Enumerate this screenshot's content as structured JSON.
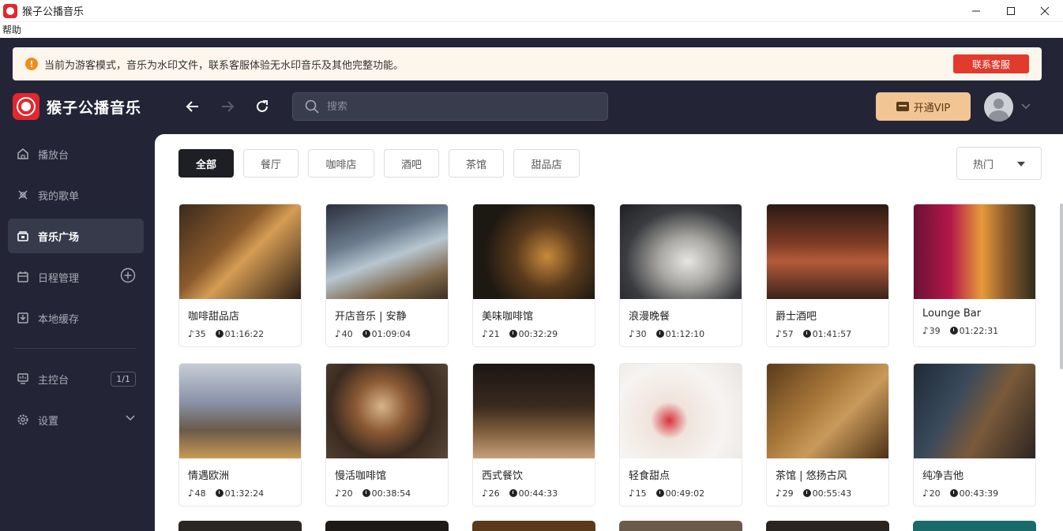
{
  "window": {
    "title": "猴子公播音乐"
  },
  "menu": {
    "help": "帮助"
  },
  "notice": {
    "text": "当前为游客模式，音乐为水印文件，联系客服体验无水印音乐及其他完整功能。",
    "button": "联系客服"
  },
  "brand": {
    "name": "猴子公播音乐"
  },
  "search": {
    "placeholder": "搜索"
  },
  "vip": {
    "label": "开通VIP"
  },
  "sidebar": {
    "items": [
      {
        "label": "播放台"
      },
      {
        "label": "我的歌单"
      },
      {
        "label": "音乐广场"
      },
      {
        "label": "日程管理"
      },
      {
        "label": "本地缓存"
      },
      {
        "label": "主控台",
        "badge": "1/1"
      },
      {
        "label": "设置"
      }
    ]
  },
  "filters": {
    "chips": [
      "全部",
      "餐厅",
      "咖啡店",
      "酒吧",
      "茶馆",
      "甜品店"
    ],
    "sort": "热门"
  },
  "playlists": [
    {
      "name": "咖啡甜品店",
      "count": "35",
      "duration": "01:16:22"
    },
    {
      "name": "开店音乐 | 安静",
      "count": "40",
      "duration": "01:09:04"
    },
    {
      "name": "美味咖啡馆",
      "count": "21",
      "duration": "00:32:29"
    },
    {
      "name": "浪漫晚餐",
      "count": "30",
      "duration": "01:12:10"
    },
    {
      "name": "爵士酒吧",
      "count": "57",
      "duration": "01:41:57"
    },
    {
      "name": "Lounge Bar",
      "count": "39",
      "duration": "01:22:31"
    },
    {
      "name": "情遇欧洲",
      "count": "48",
      "duration": "01:32:24"
    },
    {
      "name": "慢活咖啡馆",
      "count": "20",
      "duration": "00:38:54"
    },
    {
      "name": "西式餐饮",
      "count": "26",
      "duration": "00:44:33"
    },
    {
      "name": "轻食甜点",
      "count": "15",
      "duration": "00:49:02"
    },
    {
      "name": "茶馆 | 悠扬古风",
      "count": "29",
      "duration": "00:55:43"
    },
    {
      "name": "纯净吉他",
      "count": "20",
      "duration": "00:43:39"
    }
  ],
  "colors": {
    "accent": "#e3272d",
    "sidebar_bg": "#232536",
    "vip_bg": "#f2c594",
    "notice_bg": "#fdf6ec"
  }
}
